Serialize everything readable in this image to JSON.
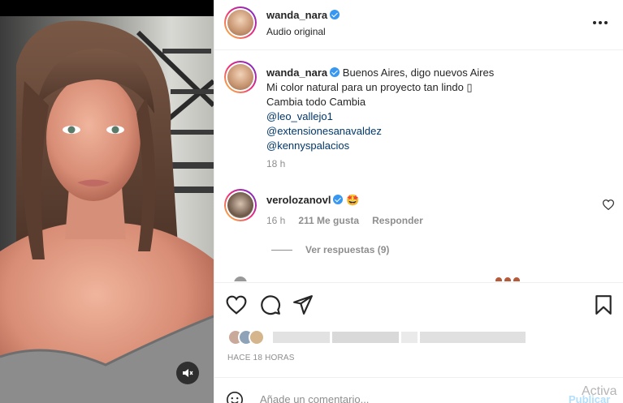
{
  "post": {
    "username": "wanda_nara",
    "audio_label": "Audio original"
  },
  "caption": {
    "username": "wanda_nara",
    "lines": [
      "Buenos Aires, digo nuevos Aires",
      "Mi color natural para un proyecto tan lindo ▯",
      "Cambia todo Cambia"
    ],
    "mentions": [
      "@leo_vallejo1",
      "@extensionesanavaldez",
      "@kennyspalacios"
    ],
    "time": "18 h"
  },
  "comment": {
    "username": "verolozanovl",
    "emoji": "🤩",
    "time": "16 h",
    "likes": "211 Me gusta",
    "reply": "Responder",
    "view_replies": "Ver respuestas (9)"
  },
  "footer": {
    "time_ago": "HACE 18 HORAS",
    "add_comment_placeholder": "Añade un comentario...",
    "publish": "Publicar"
  },
  "overlay": {
    "watermark": "Activa"
  },
  "icons": [
    "mute-icon",
    "more-icon",
    "heart-icon",
    "comment-icon",
    "share-icon",
    "bookmark-icon",
    "emoji-icon"
  ]
}
